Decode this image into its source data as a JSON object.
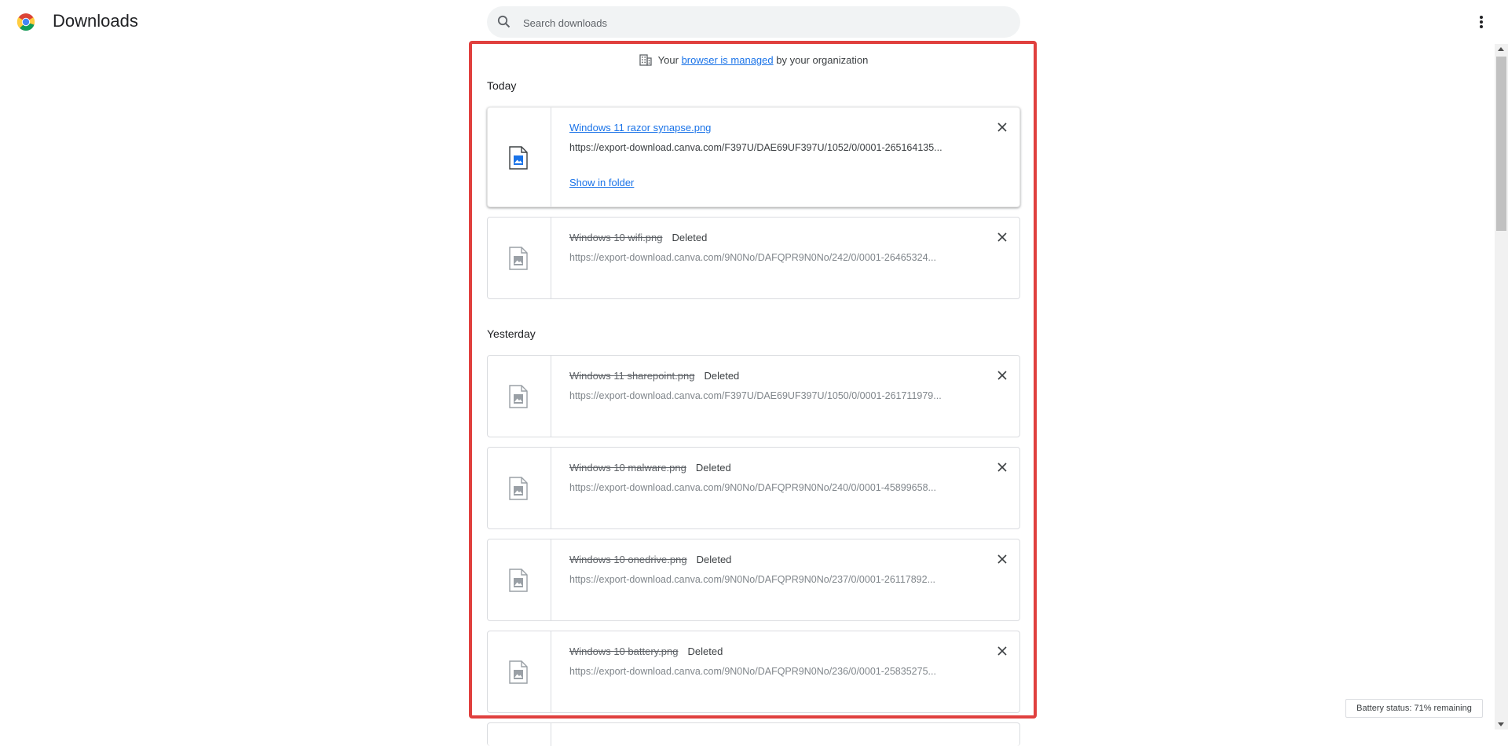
{
  "header": {
    "title": "Downloads",
    "logo_icon": "chrome-logo",
    "menu_icon": "more-vert-icon"
  },
  "search": {
    "placeholder": "Search downloads",
    "value": ""
  },
  "managed_notice": {
    "prefix": "Your",
    "link_text": "browser is managed",
    "suffix": "by your organization",
    "icon": "building-icon"
  },
  "sections": [
    {
      "label": "Today"
    },
    {
      "label": "Yesterday"
    }
  ],
  "downloads": [
    {
      "name": "Windows 11 razor synapse.png",
      "status": "",
      "url": "https://export-download.canva.com/F397U/DAE69UF397U/1052/0/0001-265164135...",
      "action": "Show in folder"
    },
    {
      "name": "Windows 10 wifi.png",
      "status": "Deleted",
      "url": "https://export-download.canva.com/9N0No/DAFQPR9N0No/242/0/0001-26465324..."
    },
    {
      "name": "Windows 11 sharepoint.png",
      "status": "Deleted",
      "url": "https://export-download.canva.com/F397U/DAE69UF397U/1050/0/0001-261711979..."
    },
    {
      "name": "Windows 10 malware.png",
      "status": "Deleted",
      "url": "https://export-download.canva.com/9N0No/DAFQPR9N0No/240/0/0001-45899658..."
    },
    {
      "name": "Windows 10 onedrive.png",
      "status": "Deleted",
      "url": "https://export-download.canva.com/9N0No/DAFQPR9N0No/237/0/0001-26117892..."
    },
    {
      "name": "Windows 10 battery.png",
      "status": "Deleted",
      "url": "https://export-download.canva.com/9N0No/DAFQPR9N0No/236/0/0001-25835275..."
    }
  ],
  "battery_status": "Battery status: 71% remaining",
  "colors": {
    "accent": "#1a73e8",
    "highlight_border": "#e0403e",
    "search_bg": "#f1f3f4"
  }
}
